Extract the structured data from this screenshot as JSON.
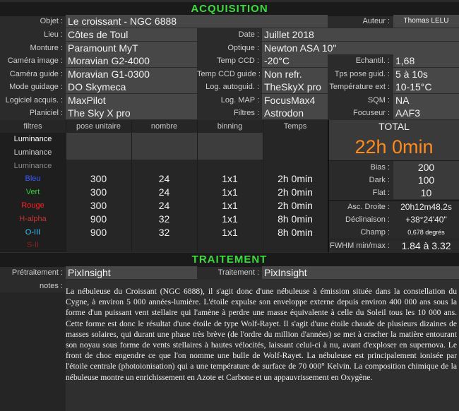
{
  "acq": {
    "title": "ACQUISITION",
    "objet_label": "Objet :",
    "objet": "Le croissant - NGC 6888",
    "auteur_label": "Auteur :",
    "auteur": "Thomas LELU",
    "lieu_label": "Lieu :",
    "lieu": "Côtes de Toul",
    "date_label": "Date :",
    "date": "Juillet 2018",
    "monture_label": "Monture :",
    "monture": "Paramount MyT",
    "optique_label": "Optique :",
    "optique": "Newton ASA 10''",
    "camera_label": "Caméra image :",
    "camera": "Moravian G2-4000",
    "tempccd_label": "Temp CCD :",
    "tempccd": "-20°C",
    "echant_label": "Echantil. :",
    "echant": "1,68",
    "camguide_label": "Caméra guide :",
    "camguide": "Moravian G1-0300",
    "tempguide_label": "Temp CCD guide :",
    "tempguide": "Non refr.",
    "tpspose_label": "Tps pose guid. :",
    "tpspose": "5 à 10s",
    "modeguid_label": "Mode guidage :",
    "modeguid": "DO Skymeca",
    "logauto_label": "Log. autoguid. :",
    "logauto": "TheSkyX pro",
    "tempext_label": "Température ext :",
    "tempext": "10-15°C",
    "logacq_label": "Logiciel acquis. :",
    "logacq": "MaxPilot",
    "logmap_label": "Log. MAP :",
    "logmap": "FocusMax4",
    "sqm_label": "SQM :",
    "sqm": "NA",
    "planiciel_label": "Planiciel :",
    "planiciel": "The Sky X pro",
    "filtres_label": "Filtres :",
    "filtres": "Astrodon",
    "focuseur_label": "Focuseur :",
    "focuseur": "AAF3"
  },
  "table": {
    "headers": [
      "filtres",
      "pose unitaire",
      "nombre",
      "binning",
      "Temps"
    ],
    "rows": [
      {
        "filter": "Luminance",
        "color": "#ffffff",
        "pose": "",
        "nombre": "",
        "binning": "",
        "temps": ""
      },
      {
        "filter": "Luminance",
        "color": "#cfcfcf",
        "pose": "",
        "nombre": "",
        "binning": "",
        "temps": ""
      },
      {
        "filter": "Luminance",
        "color": "#8a8a8a",
        "pose": "",
        "nombre": "",
        "binning": "",
        "temps": ""
      },
      {
        "filter": "Bleu",
        "color": "#3b5bff",
        "pose": "300",
        "nombre": "24",
        "binning": "1x1",
        "temps": "2h 0min"
      },
      {
        "filter": "Vert",
        "color": "#32d232",
        "pose": "300",
        "nombre": "24",
        "binning": "1x1",
        "temps": "2h 0min"
      },
      {
        "filter": "Rouge",
        "color": "#ff2222",
        "pose": "300",
        "nombre": "24",
        "binning": "1x1",
        "temps": "2h 0min"
      },
      {
        "filter": "H-alpha",
        "color": "#c83232",
        "pose": "900",
        "nombre": "32",
        "binning": "1x1",
        "temps": "8h 0min"
      },
      {
        "filter": "O-III",
        "color": "#3cc8ff",
        "pose": "900",
        "nombre": "32",
        "binning": "1x1",
        "temps": "8h 0min"
      },
      {
        "filter": "S-II",
        "color": "#8a2020",
        "pose": "",
        "nombre": "",
        "binning": "",
        "temps": ""
      }
    ]
  },
  "total": {
    "label": "TOTAL",
    "value": "22h 0min",
    "bias_label": "Bias :",
    "bias": "200",
    "dark_label": "Dark :",
    "dark": "100",
    "flat_label": "Flat :",
    "flat": "10",
    "ad_label": "Asc. Droite :",
    "ad": "20h12m48.2s",
    "dec_label": "Déclinaison :",
    "dec": "+38°24'40\"",
    "champ_label": "Champ :",
    "champ": "0,678 degrés",
    "fwhm_label": "FWHM min/max :",
    "fwhm": "1.84 à 3.32"
  },
  "trait": {
    "title": "TRAITEMENT",
    "pretrait_label": "Prétraitement :",
    "pretrait": "PixInsight",
    "trait_label": "Traitement :",
    "trait": "PixInsight",
    "notes_label": "notes :",
    "notes": "La nébuleuse du Croissant (NGC 6888), il s'agit donc d'une nébuleuse à émission située dans la constellation du Cygne, à environ 5 000 années-lumière. L'étoile expulse son enveloppe externe depuis environ 400 000 ans sous la forme d'un puissant vent stellaire qui l'amène à perdre une masse équivalente à celle du Soleil tous les 10 000 ans. Cette forme est donc le résultat d'une étoile de type Wolf-Rayet. Il s'agit d'une étoile chaude de plusieurs dizaines de masses solaires, qui durant une phase très brève (de l'ordre du million d'années) se met à cracher la matière entourant son noyau sous forme de vents stellaires à hautes vélocités, laissant celui-ci à nu, avant d'exploser en supernova. Le front de choc engendre ce que l'on nomme une bulle de Wolf-Rayet. La nébuleuse est principalement ionisée par l'étoile centrale (photoionisation) qui a une température de surface de 70 000° Kelvin. La composition chimique de la nébuleuse montre un enrichissement en Azote et Carbone et un appauvrissement en Oxygène."
  }
}
